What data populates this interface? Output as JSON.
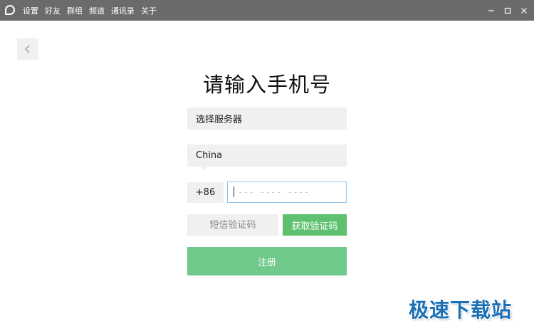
{
  "titlebar": {
    "logo_icon": "chat-bubble-icon",
    "menu": [
      {
        "label": "设置"
      },
      {
        "label": "好友"
      },
      {
        "label": "群组"
      },
      {
        "label": "频道"
      },
      {
        "label": "通讯录"
      },
      {
        "label": "关于"
      }
    ],
    "controls": [
      "minimize-icon",
      "maximize-icon",
      "close-icon"
    ],
    "background": "#6b6b6b"
  },
  "back_button": {
    "icon": "chevron-left-icon"
  },
  "page": {
    "title": "请输入手机号",
    "server_select": {
      "value": "选择服务器"
    },
    "country_select": {
      "value": "China"
    },
    "phone": {
      "country_code": "+86",
      "placeholder": "--- ---- ----",
      "value": ""
    },
    "sms_code": {
      "placeholder": "短信验证码",
      "value": ""
    },
    "get_code_label": "获取验证码",
    "register_label": "注册"
  },
  "colors": {
    "accent_green": "#5fc16f",
    "register_green": "#6fc98a",
    "input_focus_border": "#8fc7ec",
    "field_bg": "#f0f0f0"
  },
  "watermark": {
    "text": "极速下载站"
  }
}
